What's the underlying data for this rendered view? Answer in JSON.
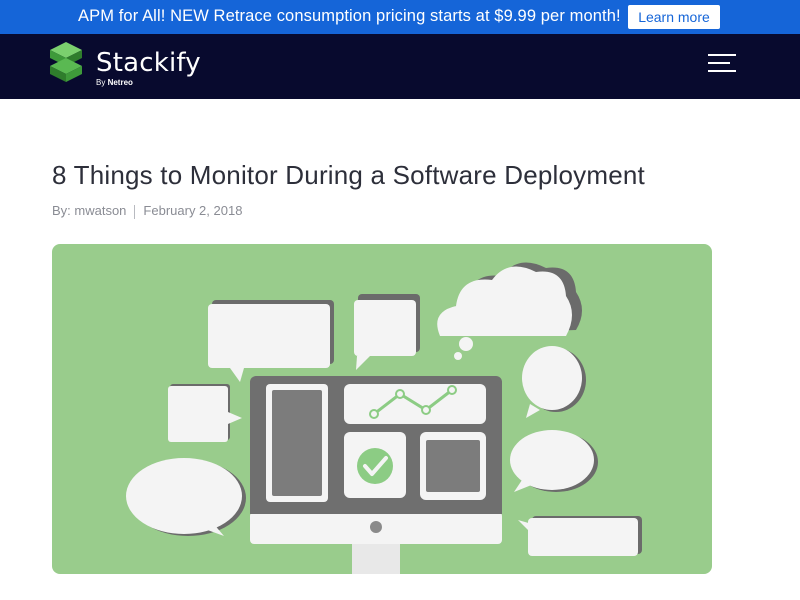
{
  "promo": {
    "text": "APM for All! NEW Retrace consumption pricing starts at $9.99 per month!",
    "button_label": "Learn more"
  },
  "nav": {
    "logo_text": "Stackify",
    "logo_by": "By",
    "logo_company": "Netreo",
    "menu_icon": "hamburger-menu-icon"
  },
  "article": {
    "title": "8 Things to Monitor During a Software Deployment",
    "author_label": "By: mwatson",
    "date": "February 2, 2018",
    "hero_icon": "monitoring-illustration"
  },
  "colors": {
    "promo_bg": "#1565d8",
    "nav_bg": "#080a2e",
    "hero_bg": "#99cc8c",
    "logo_green": "#5ab952"
  }
}
